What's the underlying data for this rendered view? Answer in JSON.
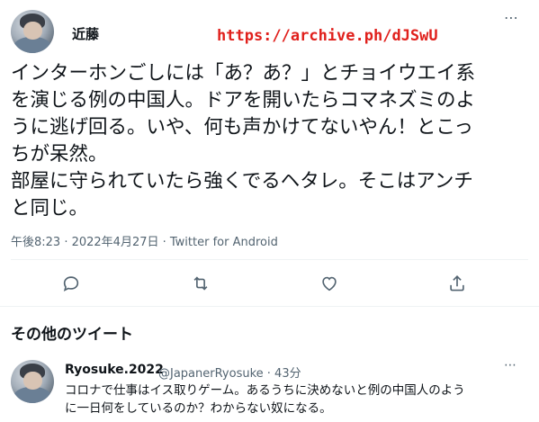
{
  "tweet": {
    "author": "近藤",
    "overlay_url": "https://archive.ph/dJSwU",
    "text_lines": [
      "インターホンごしには「あ？あ？」とチョイウエイ系",
      "を演じる例の中国人。ドアを開いたらコマネズミのよ",
      "うに逃げ回る。いや、何も声かけてないやん！とこっ",
      "ちが呆然。",
      "部屋に守られていたら強くでるヘタレ。そこはアンチ",
      "と同じ。"
    ],
    "meta": "午後8:23 · 2022年4月27日 · Twitter for Android",
    "more_icon": "⋯"
  },
  "actions": {
    "reply_icon": "speech-bubble-icon",
    "retweet_icon": "retweet-icon",
    "like_icon": "heart-icon",
    "share_icon": "share-icon"
  },
  "more_tweets": {
    "heading": "その他のツイート"
  },
  "reply": {
    "name": "Ryosuke.2022",
    "handle_time": "@JapanerRyosuke · 43分",
    "text_lines": [
      "コロナで仕事はイス取りゲーム。あるうちに決めないと例の中国人のよう",
      "に一日何をしているのか？わからない奴になる。"
    ],
    "more_icon": "⋯"
  },
  "colors": {
    "text": "#0f1419",
    "secondary": "#536471",
    "overlay_red": "#e0201c",
    "divider": "#eff3f4"
  }
}
